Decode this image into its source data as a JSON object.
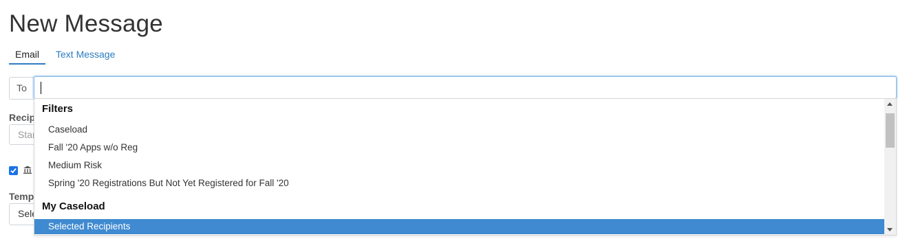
{
  "page": {
    "title": "New Message"
  },
  "tabs": [
    {
      "label": "Email",
      "active": true
    },
    {
      "label": "Text Message",
      "active": false
    }
  ],
  "to_field": {
    "addon_label": "To",
    "value": ""
  },
  "background_form": {
    "recipients_label": "Recipi",
    "recipients_placeholder": "Star",
    "template_label": "Templ",
    "template_select_value": "Sele",
    "include_checkbox_checked": true
  },
  "dropdown": {
    "groups": [
      {
        "header": "Filters",
        "options": [
          "Caseload",
          "Fall '20 Apps w/o Reg",
          "Medium Risk",
          "Spring '20 Registrations But Not Yet Registered for Fall '20"
        ]
      },
      {
        "header": "My Caseload",
        "options": [
          "Selected Recipients"
        ]
      }
    ],
    "highlighted_option": "Selected Recipients"
  },
  "colors": {
    "accent": "#2a7ac2",
    "highlight": "#3f8ad0",
    "checkbox": "#1a73e8"
  },
  "icons": [
    "checkbox-checked-icon",
    "bank-icon",
    "scroll-up-icon",
    "scroll-down-icon"
  ]
}
